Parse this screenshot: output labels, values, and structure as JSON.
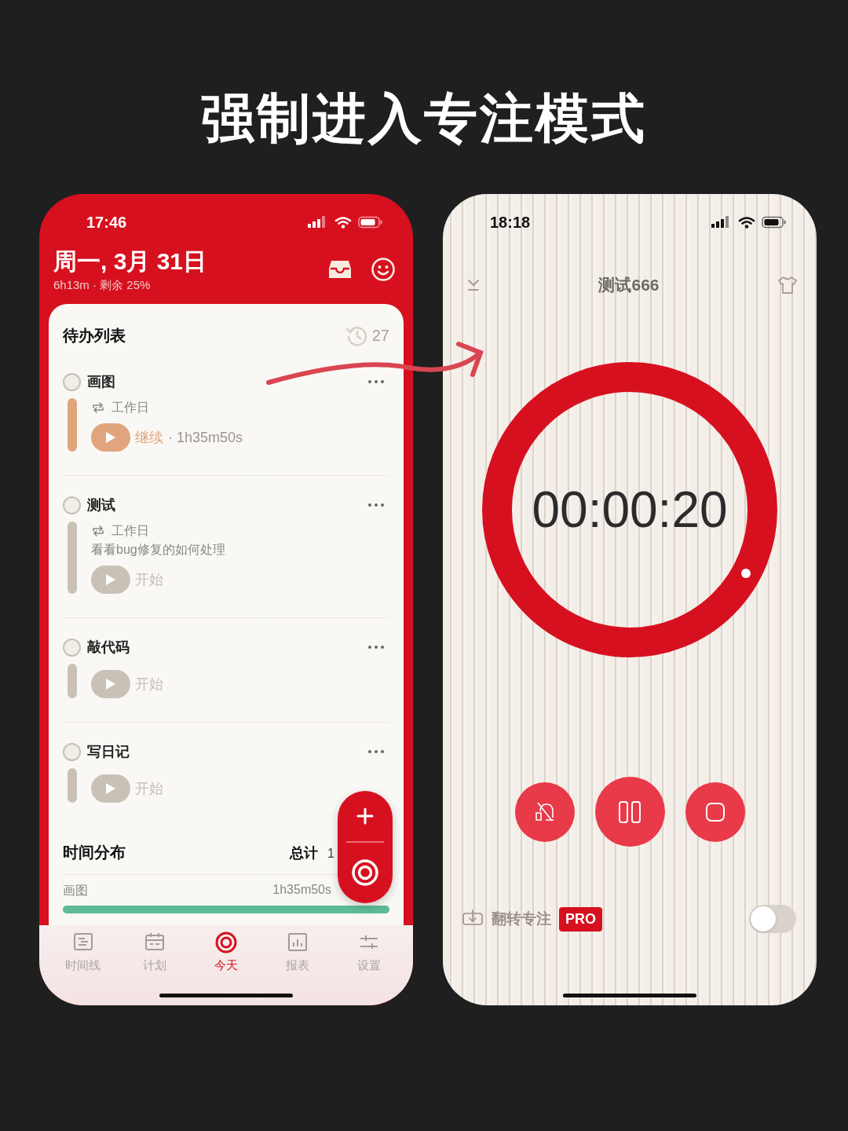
{
  "headline": "强制进入专注模式",
  "today_screen": {
    "status_bar": {
      "time": "17:46"
    },
    "header": {
      "date": "周一, 3月 31日",
      "summary": "6h13m · 剩余 25%"
    },
    "todo": {
      "title": "待办列表",
      "history_count": "27",
      "tasks": [
        {
          "title": "画图",
          "checked": false,
          "repeat": "工作日",
          "kind": "running",
          "color": "#e0a57c",
          "action": "继续",
          "elapsed": "· 1h35m50s"
        },
        {
          "title": "测试",
          "checked": false,
          "repeat": "工作日",
          "note": "看看bug修复的如何处理",
          "kind": "idle",
          "color": "#c9c1b6",
          "action": "开始"
        },
        {
          "title": "敲代码",
          "checked": false,
          "kind": "idle",
          "color": "#c9c1b6",
          "action": "开始"
        },
        {
          "title": "写日记",
          "checked": false,
          "kind": "idle",
          "color": "#c9c1b6",
          "action": "开始"
        }
      ]
    },
    "time_distribution": {
      "title": "时间分布",
      "total_label": "总计",
      "total_value": "1",
      "rows": [
        {
          "name": "画图",
          "duration": "1h35m50s",
          "level": 1,
          "color": "#5dbb98"
        }
      ]
    },
    "tab_bar": [
      {
        "label": "时间线",
        "selected": false
      },
      {
        "label": "计划",
        "selected": false
      },
      {
        "label": "今天",
        "selected": true
      },
      {
        "label": "报表",
        "selected": false
      },
      {
        "label": "设置",
        "selected": false
      }
    ]
  },
  "focus_screen": {
    "status_bar": {
      "time": "18:18"
    },
    "title": "测试666",
    "timer": {
      "time": "00:00:20"
    },
    "flip_focus": {
      "label": "翻转专注",
      "badge": "PRO",
      "on": false
    }
  }
}
